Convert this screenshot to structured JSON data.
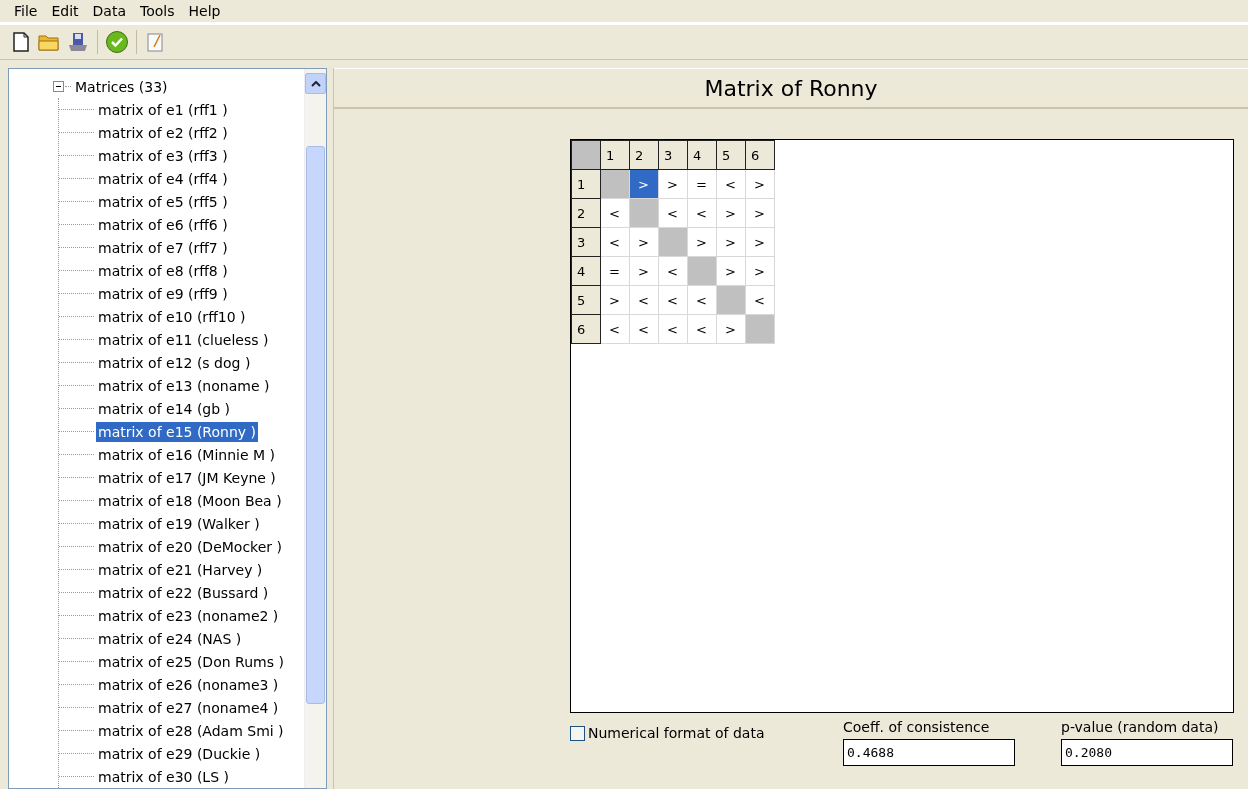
{
  "menu": [
    "File",
    "Edit",
    "Data",
    "Tools",
    "Help"
  ],
  "toolbar": [
    {
      "kind": "new"
    },
    {
      "kind": "open"
    },
    {
      "kind": "save"
    },
    {
      "kind": "sep"
    },
    {
      "kind": "check"
    },
    {
      "kind": "sep"
    },
    {
      "kind": "edit"
    }
  ],
  "tree": {
    "label": "Matrices (33)",
    "expanded": true,
    "children": [
      {
        "label": "matrix of e1 (rff1 )",
        "selected": false
      },
      {
        "label": "matrix of e2 (rff2 )",
        "selected": false
      },
      {
        "label": "matrix of e3 (rff3 )",
        "selected": false
      },
      {
        "label": "matrix of e4 (rff4 )",
        "selected": false
      },
      {
        "label": "matrix of e5 (rff5 )",
        "selected": false
      },
      {
        "label": "matrix of e6 (rff6 )",
        "selected": false
      },
      {
        "label": "matrix of e7 (rff7 )",
        "selected": false
      },
      {
        "label": "matrix of e8 (rff8 )",
        "selected": false
      },
      {
        "label": "matrix of e9 (rff9 )",
        "selected": false
      },
      {
        "label": "matrix of e10 (rff10 )",
        "selected": false
      },
      {
        "label": "matrix of e11 (clueless )",
        "selected": false
      },
      {
        "label": "matrix of e12 (s dog )",
        "selected": false
      },
      {
        "label": "matrix of e13 (noname )",
        "selected": false
      },
      {
        "label": "matrix of e14 (gb )",
        "selected": false
      },
      {
        "label": "matrix of e15 (Ronny )",
        "selected": true
      },
      {
        "label": "matrix of e16 (Minnie M )",
        "selected": false
      },
      {
        "label": "matrix of e17 (JM Keyne )",
        "selected": false
      },
      {
        "label": "matrix of e18 (Moon Bea )",
        "selected": false
      },
      {
        "label": "matrix of e19 (Walker )",
        "selected": false
      },
      {
        "label": "matrix of e20 (DeMocker )",
        "selected": false
      },
      {
        "label": "matrix of e21 (Harvey )",
        "selected": false
      },
      {
        "label": "matrix of e22 (Bussard )",
        "selected": false
      },
      {
        "label": "matrix of e23 (noname2 )",
        "selected": false
      },
      {
        "label": "matrix of e24 (NAS )",
        "selected": false
      },
      {
        "label": "matrix of e25 (Don Rums )",
        "selected": false
      },
      {
        "label": "matrix of e26 (noname3 )",
        "selected": false
      },
      {
        "label": "matrix of e27 (noname4 )",
        "selected": false
      },
      {
        "label": "matrix of e28 (Adam Smi )",
        "selected": false
      },
      {
        "label": "matrix of e29 (Duckie )",
        "selected": false
      },
      {
        "label": "matrix of e30 (LS )",
        "selected": false
      }
    ]
  },
  "panel_title": "Matrix of Ronny",
  "matrix": {
    "columns": [
      "1",
      "2",
      "3",
      "4",
      "5",
      "6"
    ],
    "rows": [
      {
        "header": "1",
        "cells": [
          {
            "kind": "diagonal",
            "selected": false
          },
          {
            "kind": "value",
            "text": ">",
            "selected": true
          },
          {
            "kind": "value",
            "text": ">",
            "selected": false
          },
          {
            "kind": "value",
            "text": "=",
            "selected": false
          },
          {
            "kind": "value",
            "text": "<",
            "selected": false
          },
          {
            "kind": "value",
            "text": ">",
            "selected": false
          }
        ]
      },
      {
        "header": "2",
        "cells": [
          {
            "kind": "value",
            "text": "<",
            "selected": false
          },
          {
            "kind": "diagonal",
            "selected": false
          },
          {
            "kind": "value",
            "text": "<",
            "selected": false
          },
          {
            "kind": "value",
            "text": "<",
            "selected": false
          },
          {
            "kind": "value",
            "text": ">",
            "selected": false
          },
          {
            "kind": "value",
            "text": ">",
            "selected": false
          }
        ]
      },
      {
        "header": "3",
        "cells": [
          {
            "kind": "value",
            "text": "<",
            "selected": false
          },
          {
            "kind": "value",
            "text": ">",
            "selected": false
          },
          {
            "kind": "diagonal",
            "selected": false
          },
          {
            "kind": "value",
            "text": ">",
            "selected": false
          },
          {
            "kind": "value",
            "text": ">",
            "selected": false
          },
          {
            "kind": "value",
            "text": ">",
            "selected": false
          }
        ]
      },
      {
        "header": "4",
        "cells": [
          {
            "kind": "value",
            "text": "=",
            "selected": false
          },
          {
            "kind": "value",
            "text": ">",
            "selected": false
          },
          {
            "kind": "value",
            "text": "<",
            "selected": false
          },
          {
            "kind": "diagonal",
            "selected": false
          },
          {
            "kind": "value",
            "text": ">",
            "selected": false
          },
          {
            "kind": "value",
            "text": ">",
            "selected": false
          }
        ]
      },
      {
        "header": "5",
        "cells": [
          {
            "kind": "value",
            "text": ">",
            "selected": false
          },
          {
            "kind": "value",
            "text": "<",
            "selected": false
          },
          {
            "kind": "value",
            "text": "<",
            "selected": false
          },
          {
            "kind": "value",
            "text": "<",
            "selected": false
          },
          {
            "kind": "diagonal",
            "selected": false
          },
          {
            "kind": "value",
            "text": "<",
            "selected": false
          }
        ]
      },
      {
        "header": "6",
        "cells": [
          {
            "kind": "value",
            "text": "<",
            "selected": false
          },
          {
            "kind": "value",
            "text": "<",
            "selected": false
          },
          {
            "kind": "value",
            "text": "<",
            "selected": false
          },
          {
            "kind": "value",
            "text": "<",
            "selected": false
          },
          {
            "kind": "value",
            "text": ">",
            "selected": false
          },
          {
            "kind": "diagonal",
            "selected": false
          }
        ]
      }
    ]
  },
  "numerical_format": {
    "label": "Numerical format of data",
    "checked": false
  },
  "coefficient": {
    "label": "Coeff. of consistence",
    "value": "0.4688"
  },
  "p_value": {
    "label": "p-value (random data)",
    "value": "0.2080"
  }
}
